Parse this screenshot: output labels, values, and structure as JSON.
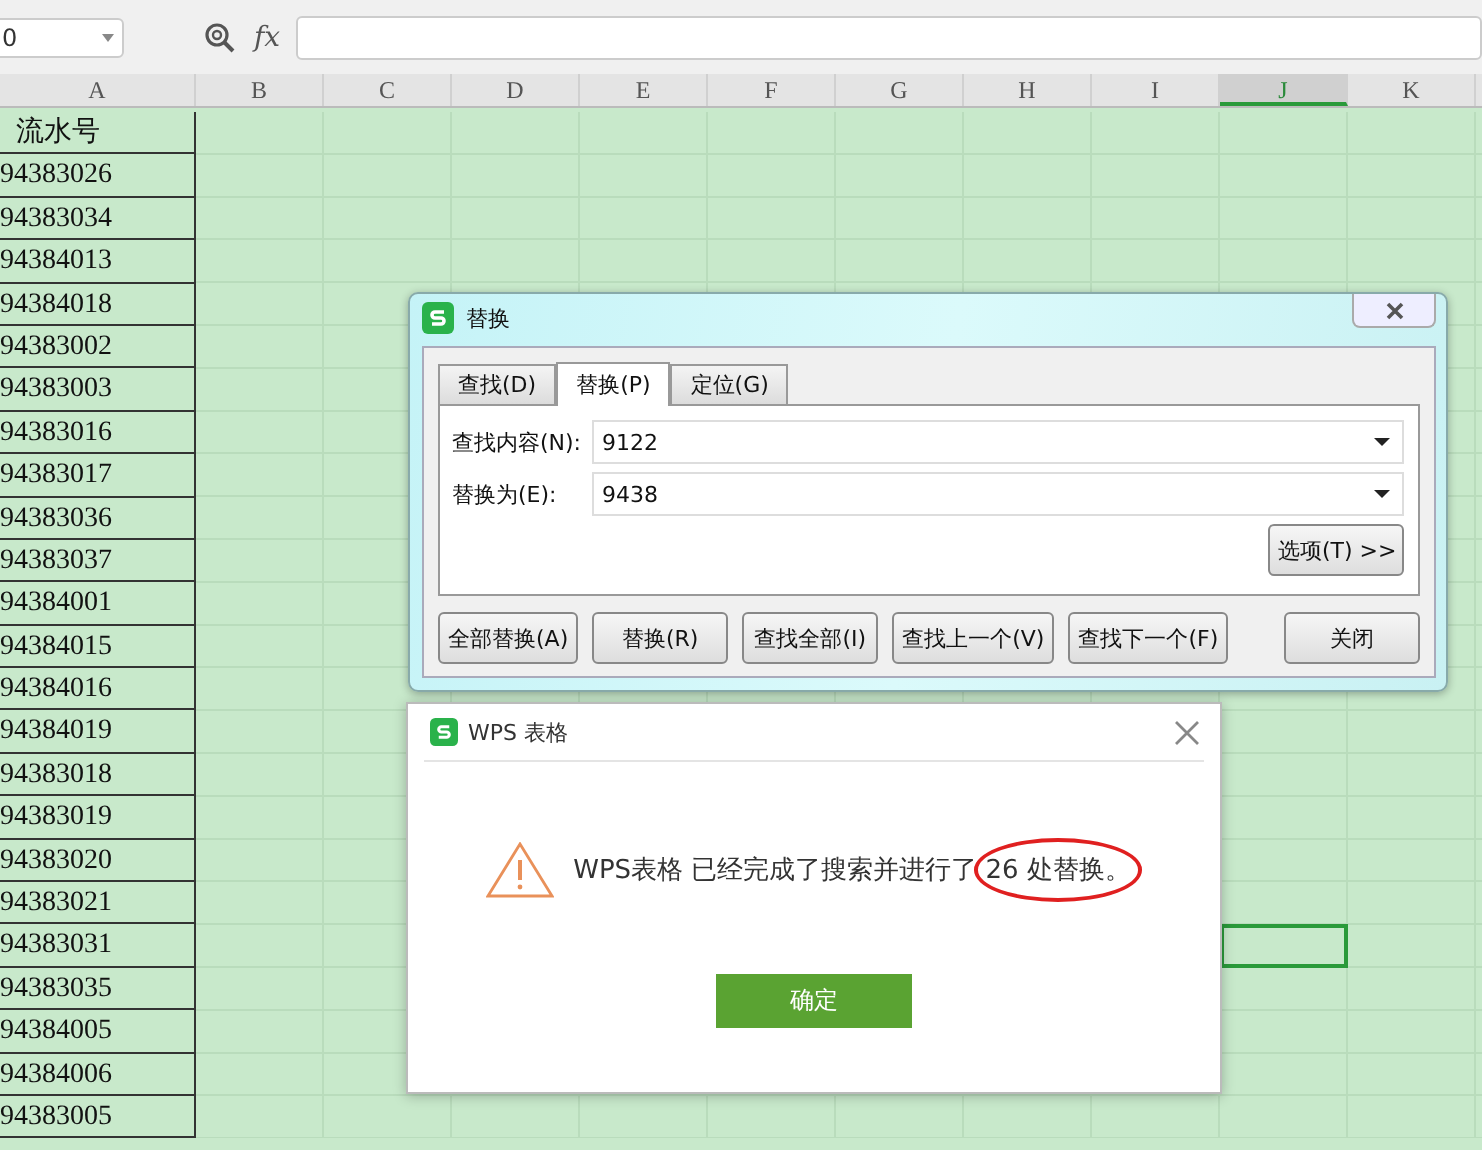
{
  "toolbar": {
    "name_box": {
      "value": "0"
    },
    "formula_label": "fx"
  },
  "columns": [
    {
      "label": "A",
      "selected": false
    },
    {
      "label": "B",
      "selected": false
    },
    {
      "label": "C",
      "selected": false
    },
    {
      "label": "D",
      "selected": false
    },
    {
      "label": "E",
      "selected": false
    },
    {
      "label": "F",
      "selected": false
    },
    {
      "label": "G",
      "selected": false
    },
    {
      "label": "H",
      "selected": false
    },
    {
      "label": "I",
      "selected": false
    },
    {
      "label": "J",
      "selected": true
    },
    {
      "label": "K",
      "selected": false
    }
  ],
  "rows": [
    {
      "value": "流水号",
      "selected": false
    },
    {
      "value": "94383026",
      "selected": false
    },
    {
      "value": "94383034",
      "selected": false
    },
    {
      "value": "94384013",
      "selected": false
    },
    {
      "value": "94384018",
      "selected": false
    },
    {
      "value": "94383002",
      "selected": false
    },
    {
      "value": "94383003",
      "selected": false
    },
    {
      "value": "94383016",
      "selected": false
    },
    {
      "value": "94383017",
      "selected": false
    },
    {
      "value": "94383036",
      "selected": false
    },
    {
      "value": "94383037",
      "selected": false
    },
    {
      "value": "94384001",
      "selected": false
    },
    {
      "value": "94384015",
      "selected": false
    },
    {
      "value": "94384016",
      "selected": false
    },
    {
      "value": "94384019",
      "selected": false
    },
    {
      "value": "94383018",
      "selected": false
    },
    {
      "value": "94383019",
      "selected": false
    },
    {
      "value": "94383020",
      "selected": false
    },
    {
      "value": "94383021",
      "selected": false
    },
    {
      "value": "94383031",
      "selected": true
    },
    {
      "value": "94383035",
      "selected": false
    },
    {
      "value": "94384005",
      "selected": false
    },
    {
      "value": "94384006",
      "selected": false
    },
    {
      "value": "94383005",
      "selected": false
    }
  ],
  "replace_dialog": {
    "title": "替换",
    "tabs": [
      {
        "label": "查找(D)",
        "selected": false
      },
      {
        "label": "替换(P)",
        "selected": true
      },
      {
        "label": "定位(G)",
        "selected": false
      }
    ],
    "fields": [
      {
        "label": "查找内容(N):",
        "value": "9122"
      },
      {
        "label": "替换为(E):",
        "value": "9438"
      }
    ],
    "options_button": "选项(T) >>",
    "buttons": [
      "全部替换(A)",
      "替换(R)",
      "查找全部(I)",
      "查找上一个(V)",
      "查找下一个(F)"
    ],
    "close_button": "关闭"
  },
  "message_dialog": {
    "title": "WPS 表格",
    "message": "WPS表格 已经完成了搜索并进行了",
    "circled": "26 处替换。",
    "ok_button": "确定"
  }
}
